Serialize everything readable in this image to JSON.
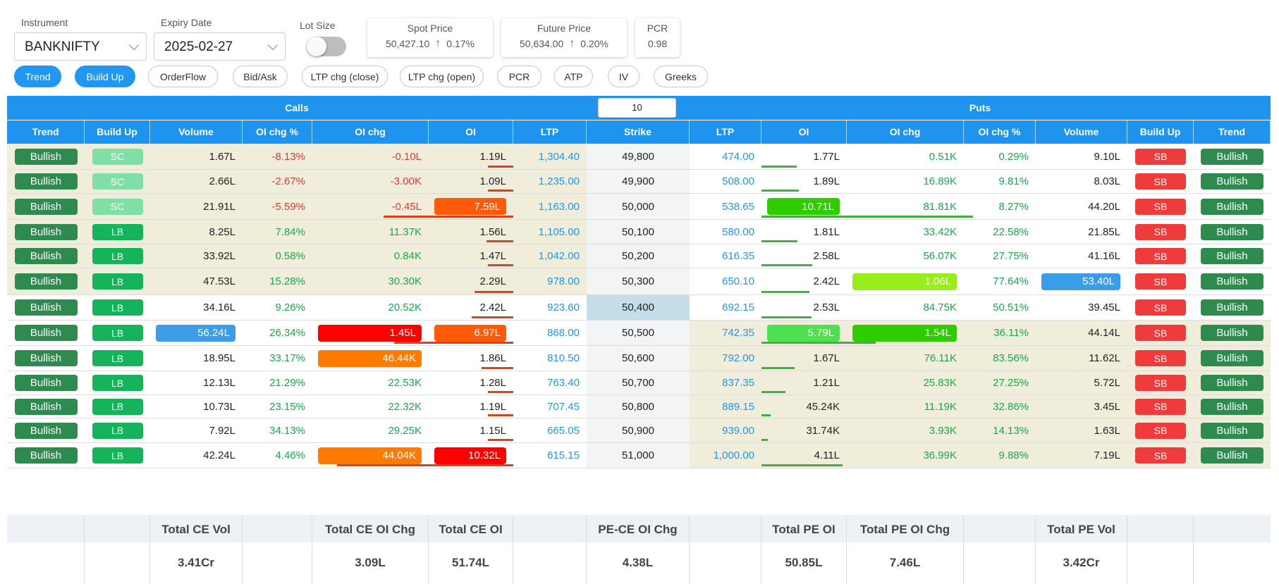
{
  "controls": {
    "instrument_label": "Instrument",
    "instrument_value": "BANKNIFTY",
    "expiry_label": "Expiry Date",
    "expiry_value": "2025-02-27",
    "lot_size_label": "Lot Size",
    "lot_size_on": false
  },
  "cards": {
    "spot": {
      "title": "Spot Price",
      "value": "50,427.10",
      "change": "0.17%"
    },
    "future": {
      "title": "Future Price",
      "value": "50,634.00",
      "change": "0.20%"
    },
    "pcr": {
      "title": "PCR",
      "value": "0.98"
    }
  },
  "tabs": [
    {
      "label": "Trend",
      "active": true
    },
    {
      "label": "Build Up",
      "active": true
    },
    {
      "label": "OrderFlow",
      "active": false
    },
    {
      "label": "Bid/Ask",
      "active": false
    },
    {
      "label": "LTP chg (close)",
      "active": false
    },
    {
      "label": "LTP chg (open)",
      "active": false
    },
    {
      "label": "PCR",
      "active": false
    },
    {
      "label": "ATP",
      "active": false
    },
    {
      "label": "IV",
      "active": false
    },
    {
      "label": "Greeks",
      "active": false
    }
  ],
  "table": {
    "calls_label": "Calls",
    "puts_label": "Puts",
    "strikes_count": "10",
    "columns": [
      "Trend",
      "Build Up",
      "Volume",
      "OI chg %",
      "OI chg",
      "OI",
      "LTP",
      "Strike",
      "LTP",
      "OI",
      "OI chg",
      "OI chg %",
      "Volume",
      "Build Up",
      "Trend"
    ],
    "atm_strike": "50,400",
    "rows": [
      {
        "strike": "49,800",
        "ce": {
          "trend": "Bullish",
          "bu": "SC",
          "vol": "1.67L",
          "oipct": "-8.13%",
          "oichg": "-0.10L",
          "oi": "1.19L",
          "ltp": "1,304.40"
        },
        "pe": {
          "trend": "Bullish",
          "bu": "SB",
          "vol": "9.10L",
          "oipct": "0.29%",
          "oichg": "0.51K",
          "oi": "1.77L",
          "ltp": "474.00"
        }
      },
      {
        "strike": "49,900",
        "ce": {
          "trend": "Bullish",
          "bu": "SC",
          "vol": "2.66L",
          "oipct": "-2.67%",
          "oichg": "-3.00K",
          "oi": "1.09L",
          "ltp": "1,235.00"
        },
        "pe": {
          "trend": "Bullish",
          "bu": "SB",
          "vol": "8.03L",
          "oipct": "9.81%",
          "oichg": "16.89K",
          "oi": "1.89L",
          "ltp": "508.00"
        }
      },
      {
        "strike": "50,000",
        "ce": {
          "trend": "Bullish",
          "bu": "SC",
          "vol": "21.91L",
          "oipct": "-5.59%",
          "oichg": "-0.45L",
          "oi": "7.59L",
          "ltp": "1,163.00"
        },
        "pe": {
          "trend": "Bullish",
          "bu": "SB",
          "vol": "44.20L",
          "oipct": "8.27%",
          "oichg": "81.81K",
          "oi": "10.71L",
          "ltp": "538.65"
        }
      },
      {
        "strike": "50,100",
        "ce": {
          "trend": "Bullish",
          "bu": "LB",
          "vol": "8.25L",
          "oipct": "7.84%",
          "oichg": "11.37K",
          "oi": "1.56L",
          "ltp": "1,105.00"
        },
        "pe": {
          "trend": "Bullish",
          "bu": "SB",
          "vol": "21.85L",
          "oipct": "22.58%",
          "oichg": "33.42K",
          "oi": "1.81L",
          "ltp": "580.00"
        }
      },
      {
        "strike": "50,200",
        "ce": {
          "trend": "Bullish",
          "bu": "LB",
          "vol": "33.92L",
          "oipct": "0.58%",
          "oichg": "0.84K",
          "oi": "1.47L",
          "ltp": "1,042.00"
        },
        "pe": {
          "trend": "Bullish",
          "bu": "SB",
          "vol": "41.16L",
          "oipct": "27.75%",
          "oichg": "56.07K",
          "oi": "2.58L",
          "ltp": "616.35"
        }
      },
      {
        "strike": "50,300",
        "ce": {
          "trend": "Bullish",
          "bu": "LB",
          "vol": "47.53L",
          "oipct": "15.28%",
          "oichg": "30.30K",
          "oi": "2.29L",
          "ltp": "978.00"
        },
        "pe": {
          "trend": "Bullish",
          "bu": "SB",
          "vol": "53.40L",
          "oipct": "77.64%",
          "oichg": "1.06L",
          "oi": "2.42L",
          "ltp": "650.10"
        }
      },
      {
        "strike": "50,400",
        "ce": {
          "trend": "Bullish",
          "bu": "LB",
          "vol": "34.16L",
          "oipct": "9.26%",
          "oichg": "20.52K",
          "oi": "2.42L",
          "ltp": "923.60"
        },
        "pe": {
          "trend": "Bullish",
          "bu": "SB",
          "vol": "39.45L",
          "oipct": "50.51%",
          "oichg": "84.75K",
          "oi": "2.53L",
          "ltp": "692.15"
        }
      },
      {
        "strike": "50,500",
        "ce": {
          "trend": "Bullish",
          "bu": "LB",
          "vol": "56.24L",
          "oipct": "26.34%",
          "oichg": "1.45L",
          "oi": "6.97L",
          "ltp": "868.00"
        },
        "pe": {
          "trend": "Bullish",
          "bu": "SB",
          "vol": "44.14L",
          "oipct": "36.11%",
          "oichg": "1.54L",
          "oi": "5.79L",
          "ltp": "742.35"
        }
      },
      {
        "strike": "50,600",
        "ce": {
          "trend": "Bullish",
          "bu": "LB",
          "vol": "18.95L",
          "oipct": "33.17%",
          "oichg": "46.44K",
          "oi": "1.86L",
          "ltp": "810.50"
        },
        "pe": {
          "trend": "Bullish",
          "bu": "SB",
          "vol": "11.62L",
          "oipct": "83.56%",
          "oichg": "76.11K",
          "oi": "1.67L",
          "ltp": "792.00"
        }
      },
      {
        "strike": "50,700",
        "ce": {
          "trend": "Bullish",
          "bu": "LB",
          "vol": "12.13L",
          "oipct": "21.29%",
          "oichg": "22.53K",
          "oi": "1.28L",
          "ltp": "763.40"
        },
        "pe": {
          "trend": "Bullish",
          "bu": "SB",
          "vol": "5.72L",
          "oipct": "27.25%",
          "oichg": "25.83K",
          "oi": "1.21L",
          "ltp": "837.35"
        }
      },
      {
        "strike": "50,800",
        "ce": {
          "trend": "Bullish",
          "bu": "LB",
          "vol": "10.73L",
          "oipct": "23.15%",
          "oichg": "22.32K",
          "oi": "1.19L",
          "ltp": "707.45"
        },
        "pe": {
          "trend": "Bullish",
          "bu": "SB",
          "vol": "3.45L",
          "oipct": "32.86%",
          "oichg": "11.19K",
          "oi": "45.24K",
          "ltp": "889.15"
        }
      },
      {
        "strike": "50,900",
        "ce": {
          "trend": "Bullish",
          "bu": "LB",
          "vol": "7.92L",
          "oipct": "34.13%",
          "oichg": "29.25K",
          "oi": "1.15L",
          "ltp": "665.05"
        },
        "pe": {
          "trend": "Bullish",
          "bu": "SB",
          "vol": "1.63L",
          "oipct": "14.13%",
          "oichg": "3.93K",
          "oi": "31.74K",
          "ltp": "939.00"
        }
      },
      {
        "strike": "51,000",
        "ce": {
          "trend": "Bullish",
          "bu": "LB",
          "vol": "42.24L",
          "oipct": "4.46%",
          "oichg": "44.04K",
          "oi": "10.32L",
          "ltp": "615.15"
        },
        "pe": {
          "trend": "Bullish",
          "bu": "SB",
          "vol": "7.19L",
          "oipct": "9.88%",
          "oichg": "36.99K",
          "oi": "4.11L",
          "ltp": "1,000.00"
        }
      }
    ]
  },
  "totals": {
    "ce_vol_label": "Total CE Vol",
    "ce_vol": "3.41Cr",
    "ce_oichg_label": "Total CE OI Chg",
    "ce_oichg": "3.09L",
    "ce_oi_label": "Total CE OI",
    "ce_oi": "51.74L",
    "pece_label": "PE-CE OI Chg",
    "pece": "4.38L",
    "pe_oi_label": "Total PE OI",
    "pe_oi": "50.85L",
    "pe_oichg_label": "Total PE OI Chg",
    "pe_oichg": "7.46L",
    "pe_vol_label": "Total PE Vol",
    "pe_vol": "3.42Cr"
  },
  "colors": {
    "header_blue": "#1e94ee",
    "itm_bg": "#f0eddb",
    "bullish_green": "#2e8b4e",
    "positive_text": "#18a94b",
    "negative_text": "#e53935",
    "ltp_blue": "#2196f3"
  }
}
